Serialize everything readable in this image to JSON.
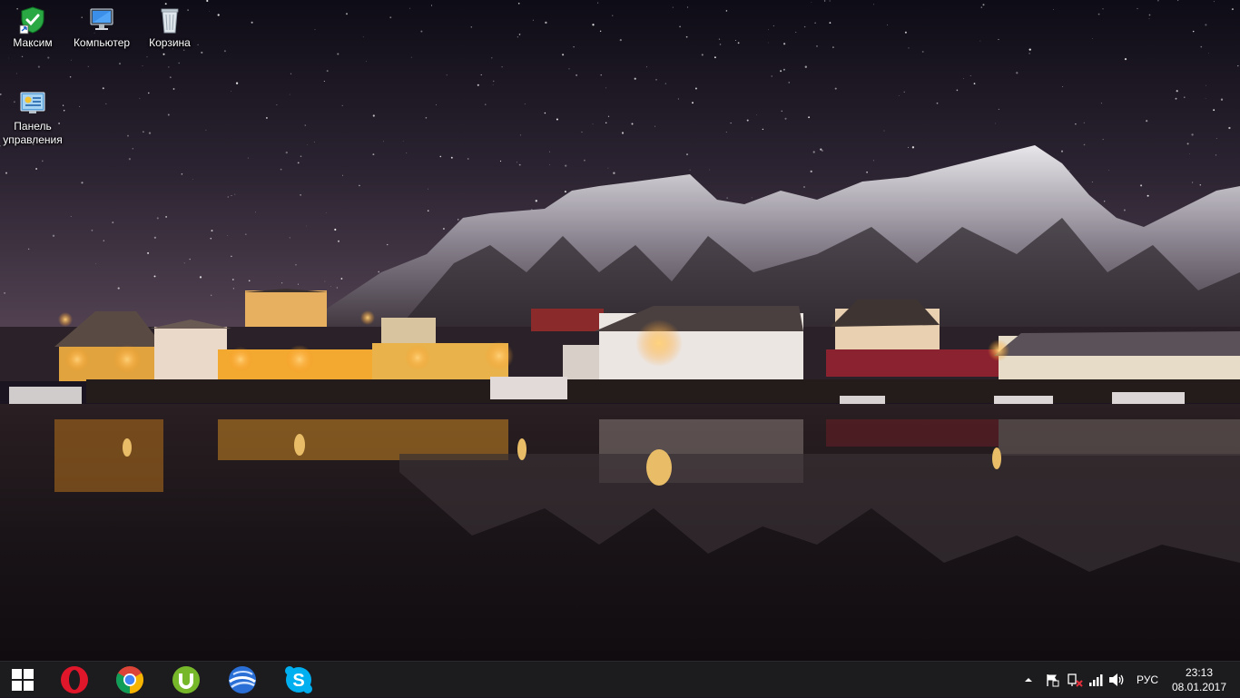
{
  "desktop": {
    "icons": [
      {
        "label": "Максим",
        "icon": "user-folder-icon"
      },
      {
        "label": "Компьютер",
        "icon": "computer-icon"
      },
      {
        "label": "Корзина",
        "icon": "recycle-bin-icon"
      },
      {
        "label": "Панель управления",
        "label_lines": [
          "Панель",
          "управления"
        ],
        "icon": "control-panel-icon"
      }
    ]
  },
  "taskbar": {
    "start": {
      "icon": "windows-start-icon"
    },
    "pinned": [
      {
        "app": "Opera",
        "icon": "opera-icon",
        "color": "#e0162b"
      },
      {
        "app": "Google Chrome",
        "icon": "chrome-icon",
        "color": "#4285f4"
      },
      {
        "app": "uTorrent",
        "icon": "utorrent-icon",
        "color": "#76b82a"
      },
      {
        "app": "Google Earth",
        "icon": "google-earth-icon",
        "color": "#2a6fd6"
      },
      {
        "app": "Skype",
        "icon": "skype-icon",
        "color": "#00aff0"
      }
    ],
    "tray": {
      "icons": [
        "show-hidden-icons-chevron",
        "action-center-flag-icon",
        "network-warning-icon",
        "signal-bars-icon",
        "volume-icon"
      ],
      "language": "РУС",
      "time": "23:13",
      "date": "08.01.2017"
    }
  },
  "colors": {
    "taskbar_bg": "#1c1c1f",
    "sky_top": "#0e0c16",
    "sky_bottom": "#5a4858",
    "light_glow": "#ffb23a",
    "water": "#1a1418"
  }
}
